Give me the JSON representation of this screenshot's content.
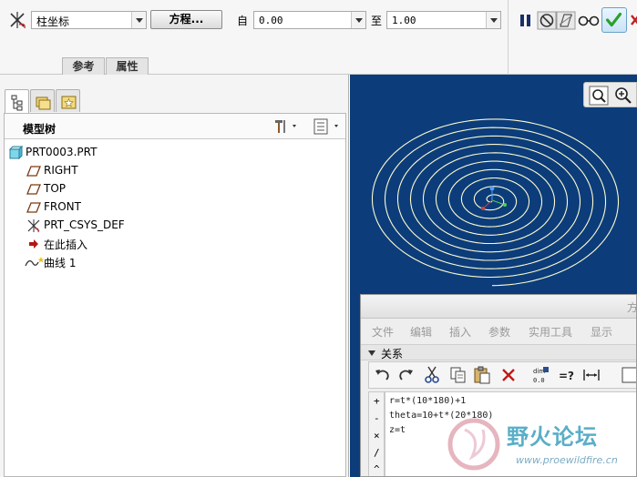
{
  "dashboard": {
    "coord_type_value": "柱坐标",
    "equation_button_label": "方程...",
    "from_label": "自",
    "from_value": "0.00",
    "to_label": "至",
    "to_value": "1.00",
    "tabs": [
      "参考",
      "属性"
    ]
  },
  "left_panel": {
    "tree_title": "模型树",
    "tree_items": [
      {
        "label": "PRT0003.PRT",
        "icon": "part-icon"
      },
      {
        "label": "RIGHT",
        "icon": "datum-plane-icon"
      },
      {
        "label": "TOP",
        "icon": "datum-plane-icon"
      },
      {
        "label": "FRONT",
        "icon": "datum-plane-icon"
      },
      {
        "label": "PRT_CSYS_DEF",
        "icon": "csys-icon"
      },
      {
        "label": "在此插入",
        "icon": "insert-arrow-icon"
      },
      {
        "label": "曲线 1",
        "icon": "curve-icon"
      }
    ]
  },
  "relations_dialog": {
    "title_partial": "方",
    "menu": [
      "文件",
      "编辑",
      "插入",
      "参数",
      "实用工具",
      "显示"
    ],
    "section_label": "关系",
    "side_buttons": [
      "+",
      "-",
      "×",
      "/",
      "^"
    ],
    "lines": [
      "r=t*(10*180)+1",
      "theta=10+t*(20*180)",
      "z=t"
    ]
  },
  "watermark": {
    "title": "野火论坛",
    "url": "www.proewildfire.cn"
  },
  "colors": {
    "graphics_bg": "#0c3d7a",
    "spiral": "#fdfbd0",
    "ok_green": "#2aa02a"
  }
}
